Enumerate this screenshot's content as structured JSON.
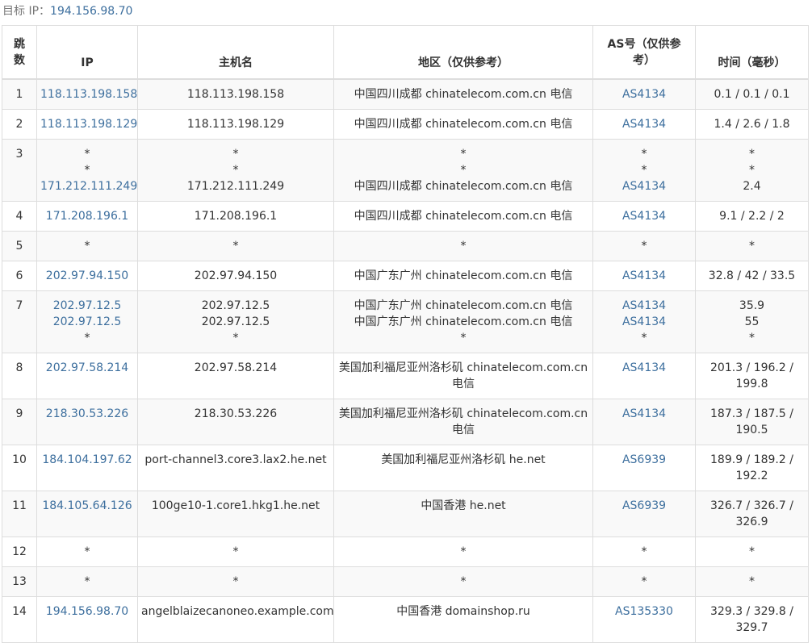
{
  "target": {
    "label": "目标 IP：",
    "ip": "194.156.98.70"
  },
  "headers": {
    "hop": "跳数",
    "ip": "IP",
    "host": "主机名",
    "region": "地区（仅供参考）",
    "as": "AS号（仅供参考）",
    "time": "时间（毫秒）"
  },
  "rows": [
    {
      "hop": "1",
      "lines": [
        {
          "ip": "118.113.198.158",
          "host": "118.113.198.158",
          "region": "中国四川成都 chinatelecom.com.cn 电信",
          "as": "AS4134",
          "time": "0.1 / 0.1 / 0.1"
        }
      ]
    },
    {
      "hop": "2",
      "lines": [
        {
          "ip": "118.113.198.129",
          "host": "118.113.198.129",
          "region": "中国四川成都 chinatelecom.com.cn 电信",
          "as": "AS4134",
          "time": "1.4 / 2.6 / 1.8"
        }
      ]
    },
    {
      "hop": "3",
      "lines": [
        {
          "ip": "*",
          "host": "*",
          "region": "*",
          "as": "*",
          "time": "*"
        },
        {
          "ip": "*",
          "host": "*",
          "region": "*",
          "as": "*",
          "time": "*"
        },
        {
          "ip": "171.212.111.249",
          "host": "171.212.111.249",
          "region": "中国四川成都 chinatelecom.com.cn 电信",
          "as": "AS4134",
          "time": "2.4"
        }
      ]
    },
    {
      "hop": "4",
      "lines": [
        {
          "ip": "171.208.196.1",
          "host": "171.208.196.1",
          "region": "中国四川成都 chinatelecom.com.cn 电信",
          "as": "AS4134",
          "time": "9.1 / 2.2 / 2"
        }
      ]
    },
    {
      "hop": "5",
      "lines": [
        {
          "ip": "*",
          "host": "*",
          "region": "*",
          "as": "*",
          "time": "*"
        }
      ]
    },
    {
      "hop": "6",
      "lines": [
        {
          "ip": "202.97.94.150",
          "host": "202.97.94.150",
          "region": "中国广东广州 chinatelecom.com.cn 电信",
          "as": "AS4134",
          "time": "32.8 / 42 / 33.5"
        }
      ]
    },
    {
      "hop": "7",
      "lines": [
        {
          "ip": "202.97.12.5",
          "host": "202.97.12.5",
          "region": "中国广东广州 chinatelecom.com.cn 电信",
          "as": "AS4134",
          "time": "35.9"
        },
        {
          "ip": "202.97.12.5",
          "host": "202.97.12.5",
          "region": "中国广东广州 chinatelecom.com.cn 电信",
          "as": "AS4134",
          "time": "55"
        },
        {
          "ip": "*",
          "host": "*",
          "region": "*",
          "as": "*",
          "time": "*"
        }
      ]
    },
    {
      "hop": "8",
      "lines": [
        {
          "ip": "202.97.58.214",
          "host": "202.97.58.214",
          "region": "美国加利福尼亚州洛杉矶 chinatelecom.com.cn 电信",
          "as": "AS4134",
          "time": "201.3 / 196.2 / 199.8"
        }
      ]
    },
    {
      "hop": "9",
      "lines": [
        {
          "ip": "218.30.53.226",
          "host": "218.30.53.226",
          "region": "美国加利福尼亚州洛杉矶 chinatelecom.com.cn 电信",
          "as": "AS4134",
          "time": "187.3 / 187.5 / 190.5"
        }
      ]
    },
    {
      "hop": "10",
      "lines": [
        {
          "ip": "184.104.197.62",
          "host": "port-channel3.core3.lax2.he.net",
          "region": "美国加利福尼亚州洛杉矶 he.net",
          "as": "AS6939",
          "time": "189.9 / 189.2 / 192.2"
        }
      ]
    },
    {
      "hop": "11",
      "lines": [
        {
          "ip": "184.105.64.126",
          "host": "100ge10-1.core1.hkg1.he.net",
          "region": "中国香港 he.net",
          "as": "AS6939",
          "time": "326.7 / 326.7 / 326.9"
        }
      ]
    },
    {
      "hop": "12",
      "lines": [
        {
          "ip": "*",
          "host": "*",
          "region": "*",
          "as": "*",
          "time": "*"
        }
      ]
    },
    {
      "hop": "13",
      "lines": [
        {
          "ip": "*",
          "host": "*",
          "region": "*",
          "as": "*",
          "time": "*"
        }
      ]
    },
    {
      "hop": "14",
      "lines": [
        {
          "ip": "194.156.98.70",
          "host": "angelblaizecanoneo.example.com",
          "region": "中国香港 domainshop.ru",
          "as": "AS135330",
          "time": "329.3 / 329.8 / 329.7"
        }
      ]
    }
  ]
}
